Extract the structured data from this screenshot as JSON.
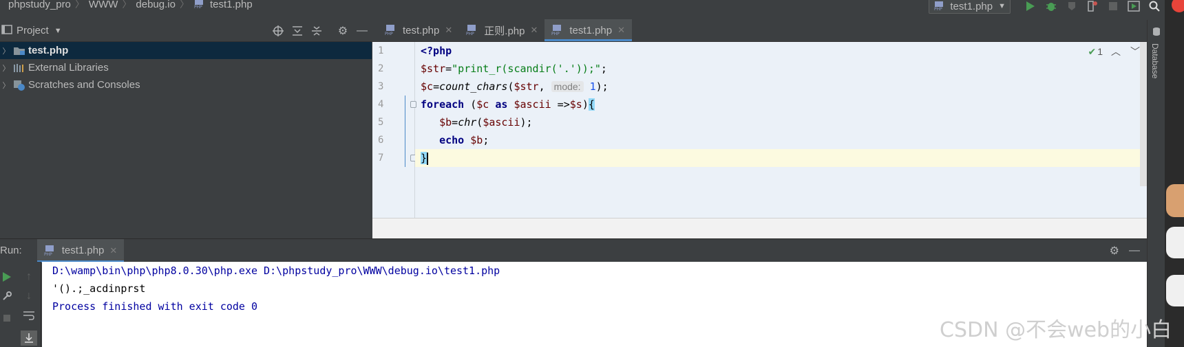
{
  "breadcrumb": {
    "items": [
      "phpstudy_pro",
      "WWW",
      "debug.io",
      "test1.php"
    ]
  },
  "run_config": {
    "label": "test1.php"
  },
  "project": {
    "title": "Project",
    "tree": [
      {
        "label": "test.php"
      },
      {
        "label": "External Libraries"
      },
      {
        "label": "Scratches and Consoles"
      }
    ]
  },
  "tabs": [
    {
      "label": "test.php"
    },
    {
      "label": "正则.php"
    },
    {
      "label": "test1.php"
    }
  ],
  "editor": {
    "line_numbers": [
      "1",
      "2",
      "3",
      "4",
      "5",
      "6",
      "7"
    ],
    "inspection_count": "1",
    "code": {
      "l1_open": "<?php",
      "l2_var": "$str",
      "l2_eq": "=",
      "l2_str": "\"print_r(scandir('.'));\"",
      "l2_end": ";",
      "l3_var": "$c",
      "l3_eq": "=",
      "l3_fn": "count_chars",
      "l3_paren": "(",
      "l3_arg": "$str",
      "l3_comma": ", ",
      "l3_hint": "mode:",
      "l3_num": "1",
      "l3_end": ");",
      "l4_kw": "foreach",
      "l4_a": " (",
      "l4_v1": "$c",
      "l4_as": " as ",
      "l4_v2": "$ascii",
      "l4_arrow": " =>",
      "l4_v3": "$s",
      "l4_close": ")",
      "l4_brace": "{",
      "l5_var": "$b",
      "l5_eq": "=",
      "l5_fn": "chr",
      "l5_paren": "(",
      "l5_arg": "$ascii",
      "l5_end": ");",
      "l6_kw": "echo",
      "l6_var": "$b",
      "l6_end": ";",
      "l7_brace": "}"
    }
  },
  "right_strip": {
    "database_label": "Database"
  },
  "run_panel": {
    "label": "Run:",
    "tab_label": "test1.php",
    "console": {
      "cmd": "D:\\wamp\\bin\\php\\php8.0.30\\php.exe D:\\phpstudy_pro\\WWW\\debug.io\\test1.php",
      "output": "'().;_acdinprst",
      "exit": "Process finished with exit code 0"
    }
  },
  "watermark": "CSDN @不会web的小白",
  "colors": {
    "accent": "#4a88c7",
    "run_green": "#499c54",
    "selection": "#0d293e"
  }
}
